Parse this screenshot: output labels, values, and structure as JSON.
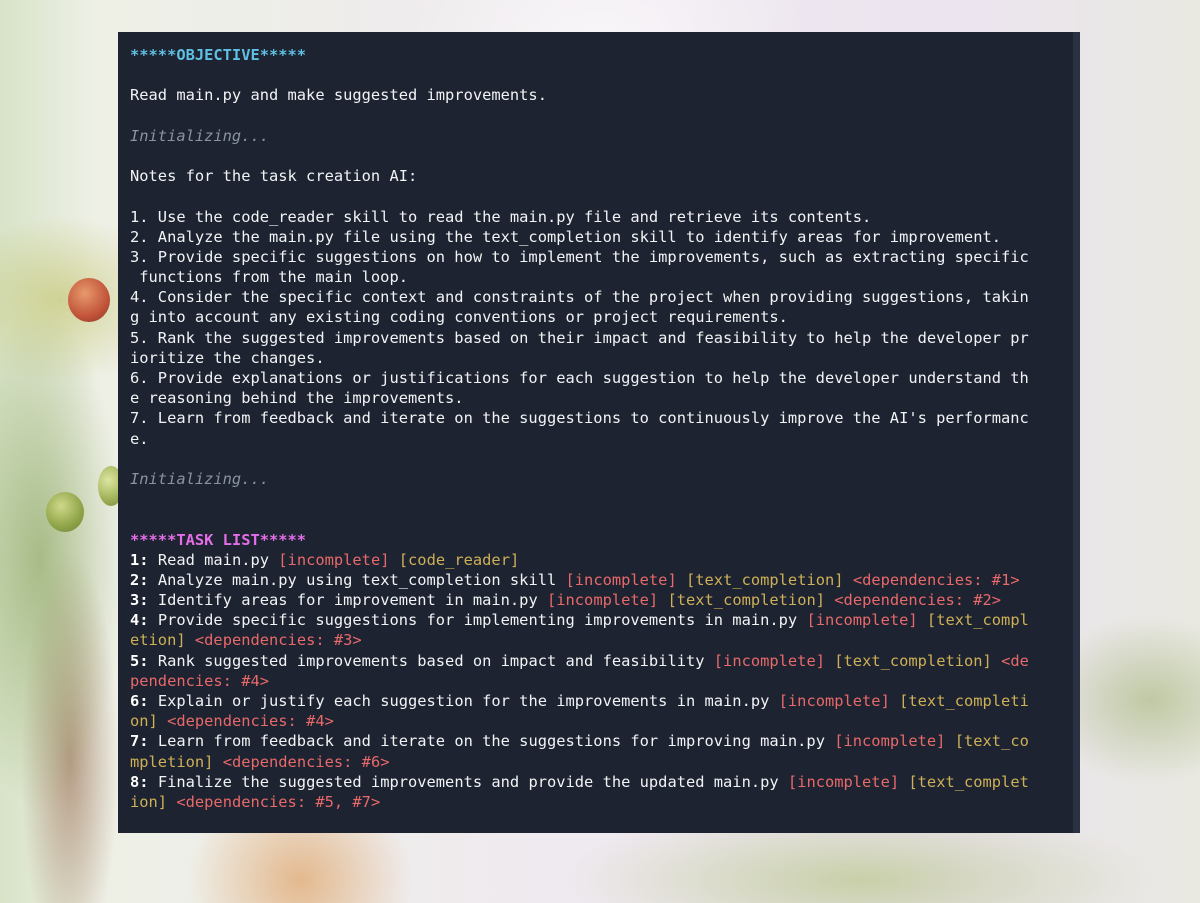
{
  "terminal": {
    "objective_header": "*****OBJECTIVE*****",
    "objective_text": "Read main.py and make suggested improvements.",
    "initializing_1": "Initializing...",
    "notes_header": "Notes for the task creation AI:",
    "notes": [
      "1. Use the code_reader skill to read the main.py file and retrieve its contents.",
      "2. Analyze the main.py file using the text_completion skill to identify areas for improvement.",
      "3. Provide specific suggestions on how to implement the improvements, such as extracting specific",
      " functions from the main loop.",
      "4. Consider the specific context and constraints of the project when providing suggestions, takin",
      "g into account any existing coding conventions or project requirements.",
      "5. Rank the suggested improvements based on their impact and feasibility to help the developer pr",
      "ioritize the changes.",
      "6. Provide explanations or justifications for each suggestion to help the developer understand th",
      "e reasoning behind the improvements.",
      "7. Learn from feedback and iterate on the suggestions to continuously improve the AI's performanc",
      "e."
    ],
    "initializing_2": "Initializing...",
    "tasklist_header": "*****TASK LIST*****",
    "task_lines": [
      [
        {
          "t": "1:",
          "c": "num"
        },
        {
          "t": " Read main.py ",
          "c": ""
        },
        {
          "t": "[incomplete]",
          "c": "status"
        },
        {
          "t": " ",
          "c": ""
        },
        {
          "t": "[code_reader]",
          "c": "skill"
        }
      ],
      [
        {
          "t": "2:",
          "c": "num"
        },
        {
          "t": " Analyze main.py using text_completion skill ",
          "c": ""
        },
        {
          "t": "[incomplete]",
          "c": "status"
        },
        {
          "t": " ",
          "c": ""
        },
        {
          "t": "[text_completion]",
          "c": "skill"
        },
        {
          "t": " ",
          "c": ""
        },
        {
          "t": "<dependencies: #1>",
          "c": "dep"
        }
      ],
      [
        {
          "t": "3:",
          "c": "num"
        },
        {
          "t": " Identify areas for improvement in main.py ",
          "c": ""
        },
        {
          "t": "[incomplete]",
          "c": "status"
        },
        {
          "t": " ",
          "c": ""
        },
        {
          "t": "[text_completion]",
          "c": "skill"
        },
        {
          "t": " ",
          "c": ""
        },
        {
          "t": "<dependencies: #2>",
          "c": "dep"
        }
      ],
      [
        {
          "t": "4:",
          "c": "num"
        },
        {
          "t": " Provide specific suggestions for implementing improvements in main.py ",
          "c": ""
        },
        {
          "t": "[incomplete]",
          "c": "status"
        },
        {
          "t": " ",
          "c": ""
        },
        {
          "t": "[text_compl",
          "c": "skill"
        }
      ],
      [
        {
          "t": "etion]",
          "c": "skill"
        },
        {
          "t": " ",
          "c": ""
        },
        {
          "t": "<dependencies: #3>",
          "c": "dep"
        }
      ],
      [
        {
          "t": "5:",
          "c": "num"
        },
        {
          "t": " Rank suggested improvements based on impact and feasibility ",
          "c": ""
        },
        {
          "t": "[incomplete]",
          "c": "status"
        },
        {
          "t": " ",
          "c": ""
        },
        {
          "t": "[text_completion]",
          "c": "skill"
        },
        {
          "t": " ",
          "c": ""
        },
        {
          "t": "<de",
          "c": "dep"
        }
      ],
      [
        {
          "t": "pendencies: #4>",
          "c": "dep"
        }
      ],
      [
        {
          "t": "6:",
          "c": "num"
        },
        {
          "t": " Explain or justify each suggestion for the improvements in main.py ",
          "c": ""
        },
        {
          "t": "[incomplete]",
          "c": "status"
        },
        {
          "t": " ",
          "c": ""
        },
        {
          "t": "[text_completi",
          "c": "skill"
        }
      ],
      [
        {
          "t": "on]",
          "c": "skill"
        },
        {
          "t": " ",
          "c": ""
        },
        {
          "t": "<dependencies: #4>",
          "c": "dep"
        }
      ],
      [
        {
          "t": "7:",
          "c": "num"
        },
        {
          "t": " Learn from feedback and iterate on the suggestions for improving main.py ",
          "c": ""
        },
        {
          "t": "[incomplete]",
          "c": "status"
        },
        {
          "t": " ",
          "c": ""
        },
        {
          "t": "[text_co",
          "c": "skill"
        }
      ],
      [
        {
          "t": "mpletion]",
          "c": "skill"
        },
        {
          "t": " ",
          "c": ""
        },
        {
          "t": "<dependencies: #6>",
          "c": "dep"
        }
      ],
      [
        {
          "t": "8:",
          "c": "num"
        },
        {
          "t": " Finalize the suggested improvements and provide the updated main.py ",
          "c": ""
        },
        {
          "t": "[incomplete]",
          "c": "status"
        },
        {
          "t": " ",
          "c": ""
        },
        {
          "t": "[text_complet",
          "c": "skill"
        }
      ],
      [
        {
          "t": "ion]",
          "c": "skill"
        },
        {
          "t": " ",
          "c": ""
        },
        {
          "t": "<dependencies: #5, #7>",
          "c": "dep"
        }
      ]
    ]
  },
  "colors": {
    "terminal_bg": "#1d2330",
    "objective_header": "#5fc0e3",
    "tasklist_header": "#e46ee8",
    "status": "#e8696a",
    "skill": "#cdb057",
    "dependency": "#e8696a",
    "dim_text": "#8a93a3"
  }
}
